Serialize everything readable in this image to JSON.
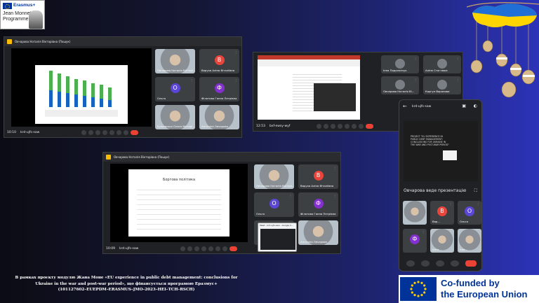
{
  "logo": {
    "erasmus": "Erasmus+",
    "line1": "Jean Monnet",
    "line2": "Programme"
  },
  "presenter": "Овчарова Наталія Вікторівна (Пошук)",
  "win1": {
    "time": "10:10",
    "code": "krd-ujfs-saw",
    "participants": [
      {
        "name": "Овчарова Наталія Вікторі...",
        "type": "camera"
      },
      {
        "name": "Варуха Аліна Віталіївна",
        "initial": "В",
        "color": "#e8453c"
      },
      {
        "name": "Ольга",
        "initial": "О",
        "color": "#5b47d6"
      },
      {
        "name": "Філатова Ганна Петрівна",
        "initial": "Ф",
        "color": "#8430ce"
      },
      {
        "name": "Бушевська Олеся Вікторі...",
        "type": "camera"
      },
      {
        "name": "Анголіна Овчарова",
        "type": "camera"
      }
    ]
  },
  "win2": {
    "time": "12:53",
    "code": "bxf-ewsy-wyf",
    "participants": [
      {
        "name": "Інна Подолянчук"
      },
      {
        "name": "Аліна Стоглюка"
      },
      {
        "name": "Овчарова Наталія Ві..."
      },
      {
        "name": "Коргун Воронова"
      }
    ]
  },
  "win3": {
    "time": "10:09",
    "code": "krd-ujfs-saw",
    "slide_title": "Боргова політика",
    "popup": "Meet - krd-ujfs-saw - Google C...",
    "participants": [
      {
        "name": "Овчарова Наталія Вікторі...",
        "type": "camera"
      },
      {
        "name": "Варуха Аліна Віталіївна",
        "initial": "В",
        "color": "#e8453c"
      },
      {
        "name": "Ольга",
        "initial": "О",
        "color": "#5b47d6"
      },
      {
        "name": "Філатова Ганна Петрівна",
        "initial": "Ф",
        "color": "#8430ce"
      },
      {
        "name": "",
        "type": "blank"
      },
      {
        "name": "Анголіна Овчарова",
        "type": "camera"
      }
    ]
  },
  "phone": {
    "code": "krd-ujfs-saw",
    "slide_text": "PROJECT \"EU EXPERIENCE IN PUBLIC DEBT MANAGEMENT: CONCLUSIONS FOR UKRAINE IN THE WAR AND POST-WAR PERIOD\"",
    "presenting": "Овчарова веде презентацію",
    "tiles": [
      {
        "name": "",
        "type": "camera"
      },
      {
        "name": "Вар...",
        "initial": "В",
        "color": "#e8453c"
      },
      {
        "name": "Ольга",
        "initial": "О",
        "color": "#5b47d6"
      },
      {
        "name": "",
        "initial": "Ф",
        "color": "#8430ce"
      },
      {
        "name": "Анге...",
        "type": "camera"
      },
      {
        "name": "Кра...",
        "type": "camera"
      }
    ]
  },
  "caption": {
    "line1": "В рамках проєкту модулю Жана Моне «EU experience in public debt management: conclusions for",
    "line2": "Ukraine in the war and post-war period», що фінансується програмою Еразмус+",
    "line3": "(101127602–EUEPDM–ERASMUS–JMO–2023–HEI–TCH–RSCH)"
  },
  "funding": {
    "line1": "Co-funded by",
    "line2": "the European Union"
  },
  "colors": {
    "eu_blue": "#003399",
    "eu_yellow": "#ffcc00",
    "meet_bg": "#202124",
    "end_call": "#ea4335"
  }
}
